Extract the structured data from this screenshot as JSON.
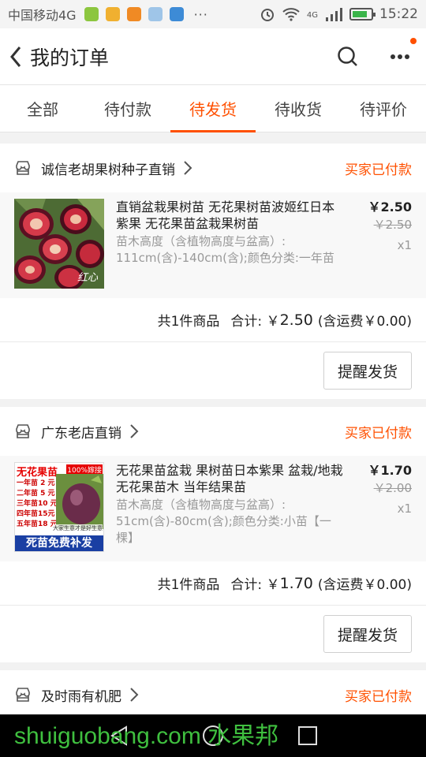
{
  "statusbar": {
    "carrier": "中国移动4G",
    "dots": "···",
    "network": "4G",
    "time": "15:22"
  },
  "header": {
    "title": "我的订单"
  },
  "tabs": [
    {
      "label": "全部"
    },
    {
      "label": "待付款"
    },
    {
      "label": "待发货"
    },
    {
      "label": "待收货"
    },
    {
      "label": "待评价"
    }
  ],
  "orders": [
    {
      "shop": "诚信老胡果树种子直销",
      "status": "买家已付款",
      "item_name": "直销盆栽果树苗 无花果树苗波姬红日本紫果 无花果苗盆栽果树苗",
      "item_spec": "苗木高度（含植物高度与盆高）: 111cm(含)-140cm(含);颜色分类:一年苗",
      "price": "￥2.50",
      "orig_price": "￥2.50",
      "qty": "x1",
      "thumb_caption": "红心",
      "summary_count": "共1件商品",
      "summary_label": "合计: ￥",
      "summary_total": "2.50",
      "summary_shipping": "(含运费￥0.00)",
      "action": "提醒发货"
    },
    {
      "shop": "广东老店直销",
      "status": "买家已付款",
      "item_name": "无花果苗盆栽 果树苗日本紫果 盆栽/地栽无花果苗木 当年结果苗",
      "item_spec": "苗木高度（含植物高度与盆高）: 51cm(含)-80cm(含);颜色分类:小苗【一棵】",
      "price": "￥1.70",
      "orig_price": "￥2.00",
      "qty": "x1",
      "thumb": {
        "title": "无花果苗",
        "badge": "100%嫁接",
        "lines": [
          "一年苗 2 元",
          "二年苗 5 元",
          "三年苗10 元",
          "四年苗15元",
          "五年苗18 元"
        ],
        "side_text": "大家生意才是好生意",
        "footer": "死苗免费补发"
      },
      "summary_count": "共1件商品",
      "summary_label": "合计: ￥",
      "summary_total": "1.70",
      "summary_shipping": "(含运费￥0.00)",
      "action": "提醒发货"
    },
    {
      "shop": "及时雨有机肥",
      "status": "买家已付款"
    }
  ],
  "watermark": "shuiguobang.com 水果邦",
  "colors": {
    "accent": "#ff5000",
    "muted_text": "#999999",
    "divider": "#eaeaea"
  }
}
